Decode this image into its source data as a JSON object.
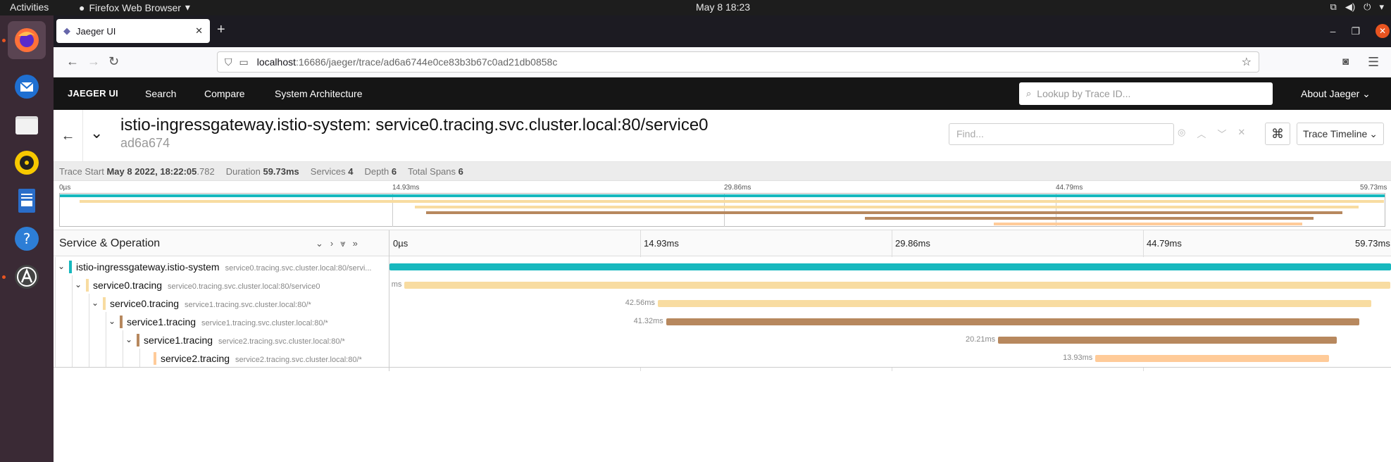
{
  "os": {
    "activities": "Activities",
    "app_menu": "Firefox Web Browser",
    "clock": "May 8  18:23"
  },
  "browser": {
    "tab_title": "Jaeger UI",
    "url_host": "localhost",
    "url_path": ":16686/jaeger/trace/ad6a6744e0ce83b3b67c0ad21db0858c"
  },
  "jaeger_nav": {
    "brand": "JAEGER UI",
    "search": "Search",
    "compare": "Compare",
    "system_architecture": "System Architecture",
    "lookup_placeholder": "Lookup by Trace ID...",
    "about": "About Jaeger"
  },
  "trace": {
    "title": "istio-ingressgateway.istio-system: service0.tracing.svc.cluster.local:80/service0",
    "short_id": "ad6a674",
    "find_placeholder": "Find...",
    "view_mode": "Trace Timeline",
    "meta": {
      "start_label": "Trace Start",
      "start_value": "May 8 2022, 18:22:05",
      "start_ms": ".782",
      "duration_label": "Duration",
      "duration_value": "59.73ms",
      "services_label": "Services",
      "services_value": "4",
      "depth_label": "Depth",
      "depth_value": "6",
      "spans_label": "Total Spans",
      "spans_value": "6"
    }
  },
  "minimap_ticks": [
    "0µs",
    "14.93ms",
    "29.86ms",
    "44.79ms",
    "59.73ms"
  ],
  "timeline": {
    "column_title": "Service & Operation",
    "ticks": [
      "0µs",
      "14.93ms",
      "29.86ms",
      "44.79ms",
      "59.73ms"
    ]
  },
  "colors": {
    "teal": "#17b8be",
    "light_orange": "#f8dca1",
    "brown": "#b7885e",
    "peach": "#ffcb99"
  },
  "spans": [
    {
      "service": "istio-ingressgateway.istio-system",
      "operation": "service0.tracing.svc.cluster.local:80/servi...",
      "depth": 0,
      "start_ms": 0,
      "dur_ms": 59.73,
      "dur_label": "",
      "color": "#17b8be"
    },
    {
      "service": "service0.tracing",
      "operation": "service0.tracing.svc.cluster.local:80/service0",
      "depth": 1,
      "start_ms": 0.9,
      "dur_ms": 58.8,
      "dur_label": "ms",
      "color": "#f8dca1"
    },
    {
      "service": "service0.tracing",
      "operation": "service1.tracing.svc.cluster.local:80/*",
      "depth": 2,
      "start_ms": 16.0,
      "dur_ms": 42.56,
      "dur_label": "42.56ms",
      "color": "#f8dca1"
    },
    {
      "service": "service1.tracing",
      "operation": "service1.tracing.svc.cluster.local:80/*",
      "depth": 3,
      "start_ms": 16.5,
      "dur_ms": 41.32,
      "dur_label": "41.32ms",
      "color": "#b7885e"
    },
    {
      "service": "service1.tracing",
      "operation": "service2.tracing.svc.cluster.local:80/*",
      "depth": 4,
      "start_ms": 36.3,
      "dur_ms": 20.21,
      "dur_label": "20.21ms",
      "color": "#b7885e"
    },
    {
      "service": "service2.tracing",
      "operation": "service2.tracing.svc.cluster.local:80/*",
      "depth": 5,
      "start_ms": 42.1,
      "dur_ms": 13.93,
      "dur_label": "13.93ms",
      "color": "#ffcb99"
    }
  ],
  "total_ms": 59.73
}
